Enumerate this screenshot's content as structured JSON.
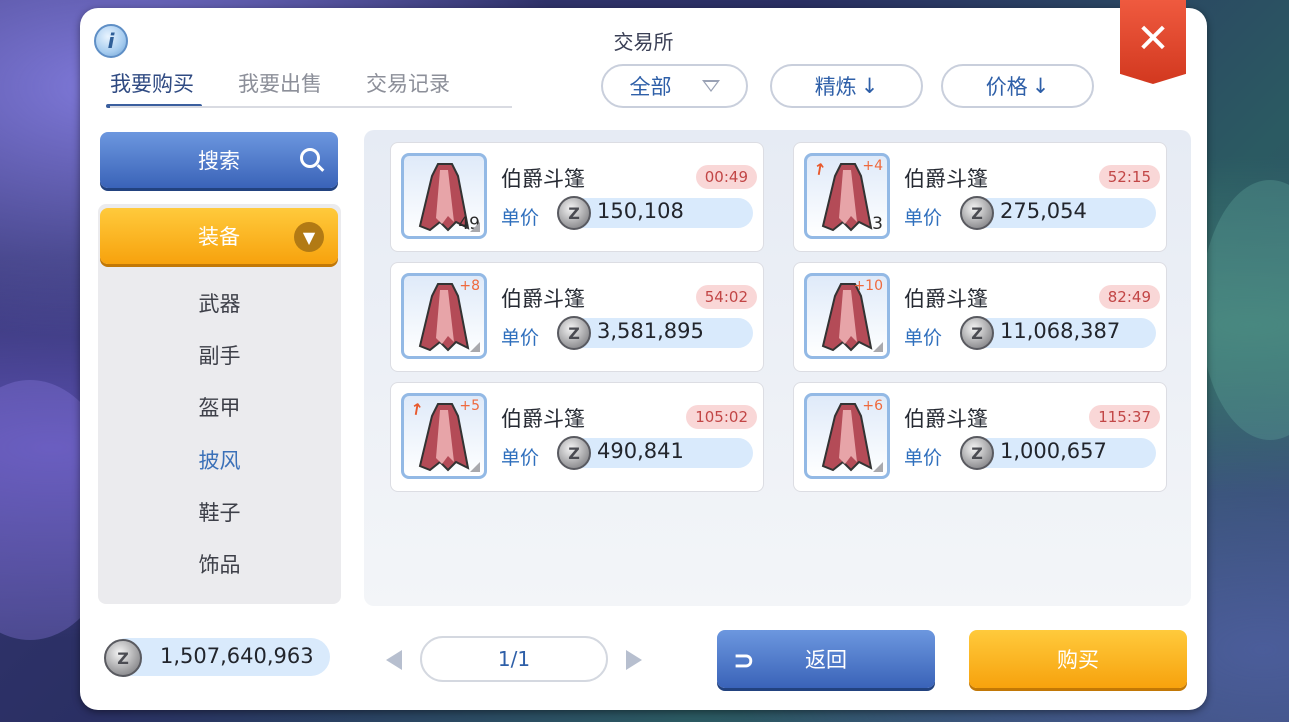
{
  "window": {
    "title": "交易所"
  },
  "tabs": [
    {
      "label": "我要购买",
      "active": true
    },
    {
      "label": "我要出售",
      "active": false
    },
    {
      "label": "交易记录",
      "active": false
    }
  ],
  "filters": {
    "category_select": "全部",
    "sort_refine": "精炼",
    "sort_refine_arrow": "↓",
    "sort_price": "价格",
    "sort_price_arrow": "↓"
  },
  "sidebar": {
    "search_label": "搜索",
    "group_label": "装备",
    "items": [
      {
        "label": "武器",
        "active": false
      },
      {
        "label": "副手",
        "active": false
      },
      {
        "label": "盔甲",
        "active": false
      },
      {
        "label": "披风",
        "active": true
      },
      {
        "label": "鞋子",
        "active": false
      },
      {
        "label": "饰品",
        "active": false
      }
    ]
  },
  "listings": [
    {
      "name": "伯爵斗篷",
      "timer": "00:49",
      "price_label": "单价",
      "price": "150,108",
      "count": "49",
      "refine": "",
      "hammer": false
    },
    {
      "name": "伯爵斗篷",
      "timer": "52:15",
      "price_label": "单价",
      "price": "275,054",
      "count": "3",
      "refine": "+4",
      "hammer": true
    },
    {
      "name": "伯爵斗篷",
      "timer": "54:02",
      "price_label": "单价",
      "price": "3,581,895",
      "count": "",
      "refine": "+8",
      "hammer": false
    },
    {
      "name": "伯爵斗篷",
      "timer": "82:49",
      "price_label": "单价",
      "price": "11,068,387",
      "count": "",
      "refine": "+10",
      "hammer": false
    },
    {
      "name": "伯爵斗篷",
      "timer": "105:02",
      "price_label": "单价",
      "price": "490,841",
      "count": "",
      "refine": "+5",
      "hammer": true
    },
    {
      "name": "伯爵斗篷",
      "timer": "115:37",
      "price_label": "单价",
      "price": "1,000,657",
      "count": "",
      "refine": "+6",
      "hammer": false
    }
  ],
  "footer": {
    "money": "1,507,640,963",
    "page": "1/1",
    "back_label": "返回",
    "buy_label": "购买"
  },
  "icons": {
    "info": "i",
    "close": "✕",
    "coin": "Z",
    "chevron": "⌄",
    "back": "⊃"
  },
  "colors": {
    "primary_blue": "#3a63b8",
    "accent_orange": "#f7a20d",
    "close_red": "#d2381f",
    "timer_bg": "#f9d7d7",
    "timer_text": "#c24646"
  }
}
